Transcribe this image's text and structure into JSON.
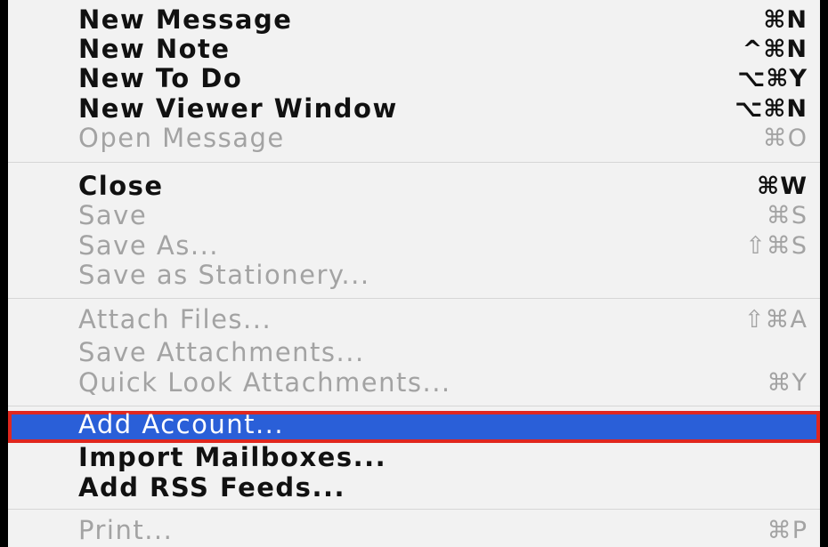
{
  "menu": {
    "items": [
      {
        "label": "New Message",
        "shortcut": "⌘N"
      },
      {
        "label": "New Note",
        "shortcut": "^⌘N"
      },
      {
        "label": "New To Do",
        "shortcut": "⌥⌘Y"
      },
      {
        "label": "New Viewer Window",
        "shortcut": "⌥⌘N"
      },
      {
        "label": "Open Message",
        "shortcut": "⌘O"
      },
      {
        "label": "Close",
        "shortcut": "⌘W"
      },
      {
        "label": "Save",
        "shortcut": "⌘S"
      },
      {
        "label": "Save As...",
        "shortcut": "⇧⌘S"
      },
      {
        "label": "Save as Stationery..."
      },
      {
        "label": "Attach Files...",
        "shortcut": "⇧⌘A"
      },
      {
        "label": "Save Attachments..."
      },
      {
        "label": "Quick Look Attachments...",
        "shortcut": "⌘Y"
      },
      {
        "label": "Add Account..."
      },
      {
        "label": "Import Mailboxes..."
      },
      {
        "label": "Add RSS Feeds..."
      },
      {
        "label": "Print...",
        "shortcut": "⌘P"
      }
    ]
  },
  "colors": {
    "highlight": "#2a5fd8",
    "highlight_outline": "#e0271f",
    "enabled_text": "#111111",
    "disabled_text": "#a3a3a3"
  }
}
